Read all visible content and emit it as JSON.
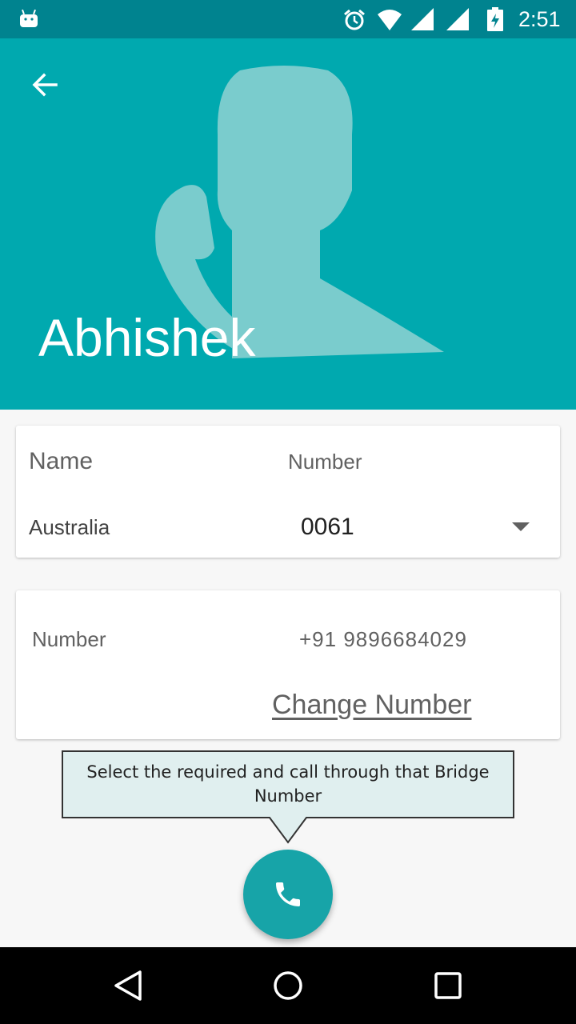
{
  "status_bar": {
    "time": "2:51",
    "icons": [
      "android-icon",
      "alarm-icon",
      "wifi-icon",
      "signal-icon",
      "battery-icon"
    ]
  },
  "header": {
    "contact_name": "Abhishek",
    "back_icon": "arrow-back-icon",
    "color": "#00a9af"
  },
  "country_card": {
    "name_label": "Name",
    "number_label": "Number",
    "country": "Australia",
    "code": "0061"
  },
  "number_card": {
    "label": "Number",
    "value": "+91 9896684029",
    "change_link": "Change Number"
  },
  "tooltip": {
    "text": "Select the required and call through that Bridge Number"
  },
  "fab": {
    "icon": "phone-icon",
    "color": "#17a4a8"
  },
  "nav_bar": {
    "icons": [
      "nav-back-icon",
      "nav-home-icon",
      "nav-recents-icon"
    ]
  }
}
